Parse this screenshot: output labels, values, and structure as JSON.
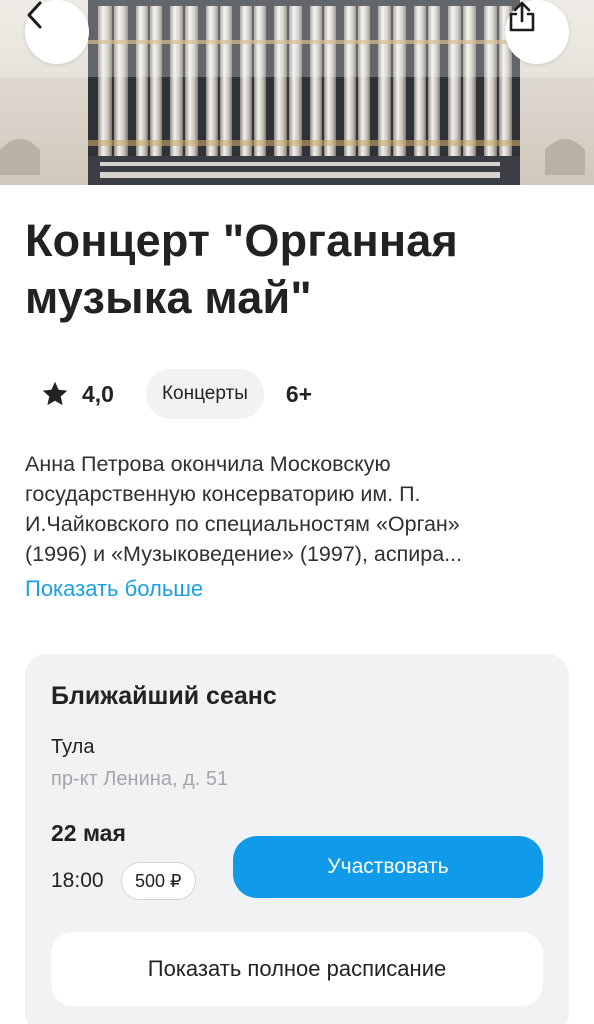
{
  "hero": {
    "image": "organ-pipes-photo",
    "back_icon": "chevron-left-icon",
    "share_icon": "share-icon"
  },
  "event": {
    "title": "Концерт \"Органная музыка май\"",
    "rating": "4,0",
    "rating_icon": "star-icon",
    "category": "Концерты",
    "age": "6+",
    "description_lines": [
      "Анна Петрова окончила Московскую",
      "государственную консерваторию им. П.",
      "И.Чайковского по специальностям «Орган»",
      "(1996) и «Музыковедение» (1997), аспира..."
    ],
    "show_more": "Показать больше"
  },
  "session": {
    "heading": "Ближайший сеанс",
    "city": "Тула",
    "address": "пр-кт Ленина, д. 51",
    "date": "22 мая",
    "time": "18:00",
    "price": "500 ₽",
    "cta": "Участвовать",
    "schedule_button": "Показать полное расписание"
  },
  "colors": {
    "accent": "#109bea",
    "link": "#1a9fe6",
    "card_bg": "#f1f2f4"
  }
}
